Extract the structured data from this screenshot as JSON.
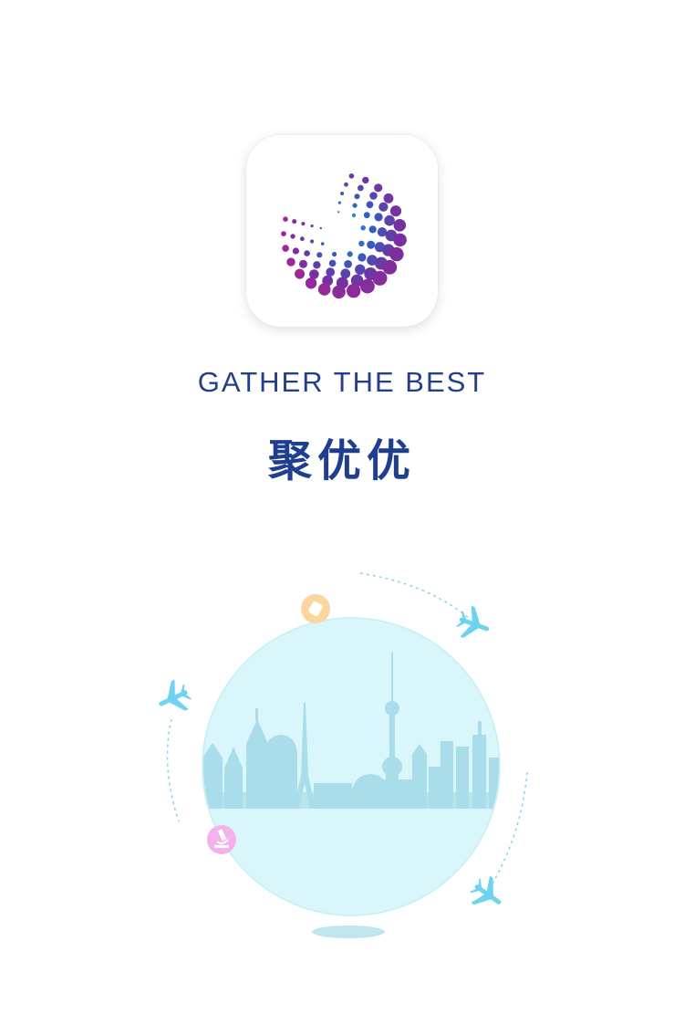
{
  "app": {
    "logo_icon": "dot-swirl-logo",
    "tagline": "GATHER THE BEST",
    "brand_name": "聚优优"
  },
  "illustration": {
    "icons": [
      "world-skyline-globe-icon",
      "airplane-icon",
      "microscope-icon",
      "badge-icon"
    ]
  },
  "colors": {
    "brand_blue": "#233f8c",
    "logo_gradient": [
      "#34a7e0",
      "#2f5fc0",
      "#7a2f9e",
      "#d81b8c"
    ],
    "globe_fill": "#d9f7fb",
    "plane": "#6ed3ef",
    "microscope_badge": "#f3b2ea",
    "tag_badge": "#fbd69d"
  }
}
